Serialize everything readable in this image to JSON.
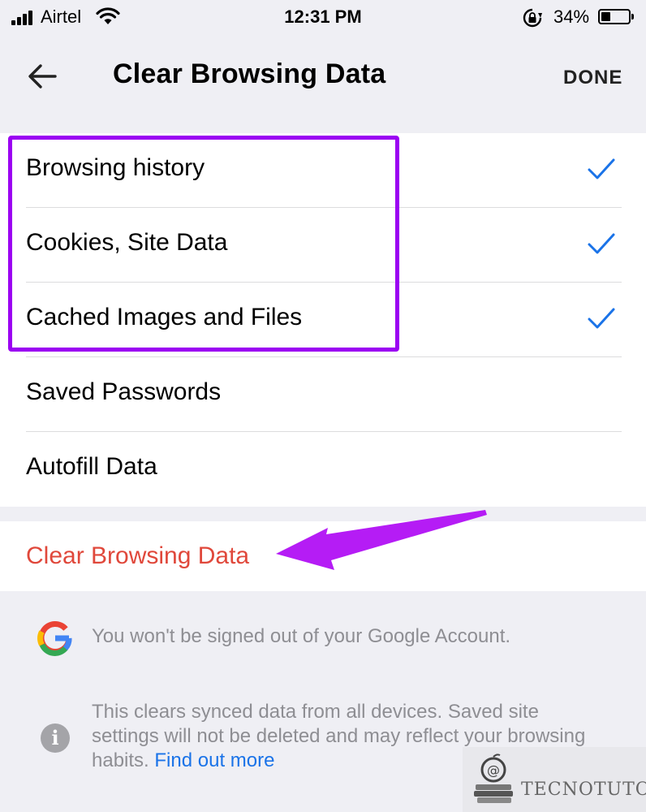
{
  "status_bar": {
    "carrier": "Airtel",
    "time": "12:31 PM",
    "battery_percent": "34%",
    "battery_level": 0.34
  },
  "nav": {
    "title": "Clear Browsing Data",
    "done_label": "DONE",
    "back_icon": "arrow-left-icon"
  },
  "options": [
    {
      "label": "Browsing history",
      "checked": true
    },
    {
      "label": "Cookies, Site Data",
      "checked": true
    },
    {
      "label": "Cached Images and Files",
      "checked": true
    },
    {
      "label": "Saved Passwords",
      "checked": false
    },
    {
      "label": "Autofill Data",
      "checked": false
    }
  ],
  "clear_action": {
    "label": "Clear Browsing Data"
  },
  "info": {
    "google_note": "You won't be signed out of your Google Account.",
    "sync_note": "This clears synced data from all devices. Saved site settings will not be deleted and may reflect your browsing habits.",
    "find_out_more": "Find out more"
  },
  "watermark": {
    "text": "TECNOTUTO"
  },
  "colors": {
    "accent_blue": "#1a73e8",
    "destructive_red": "#e0483b",
    "highlight_purple": "#9b00f2",
    "background": "#efeff4"
  }
}
